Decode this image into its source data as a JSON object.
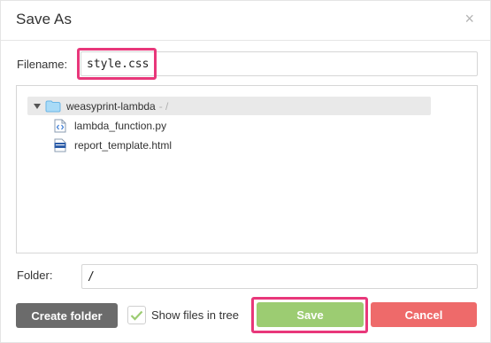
{
  "dialog": {
    "title": "Save As",
    "close_glyph": "×"
  },
  "filename": {
    "label": "Filename:",
    "value": "style.css"
  },
  "tree": {
    "root": {
      "name": "weasyprint-lambda",
      "suffix": "- /",
      "icon": "folder-icon"
    },
    "files": [
      {
        "name": "lambda_function.py",
        "icon": "code-file-icon"
      },
      {
        "name": "report_template.html",
        "icon": "html-file-icon"
      }
    ]
  },
  "folder": {
    "label": "Folder:",
    "value": "/"
  },
  "buttons": {
    "create_folder": "Create folder",
    "show_files_label": "Show files in tree",
    "show_files_checked": true,
    "save": "Save",
    "cancel": "Cancel"
  },
  "colors": {
    "highlight": "#e8377a",
    "save": "#9ccc72",
    "cancel": "#ee6a6a",
    "create_folder": "#6b6b6b",
    "folder_icon": "#7cc3ef"
  }
}
